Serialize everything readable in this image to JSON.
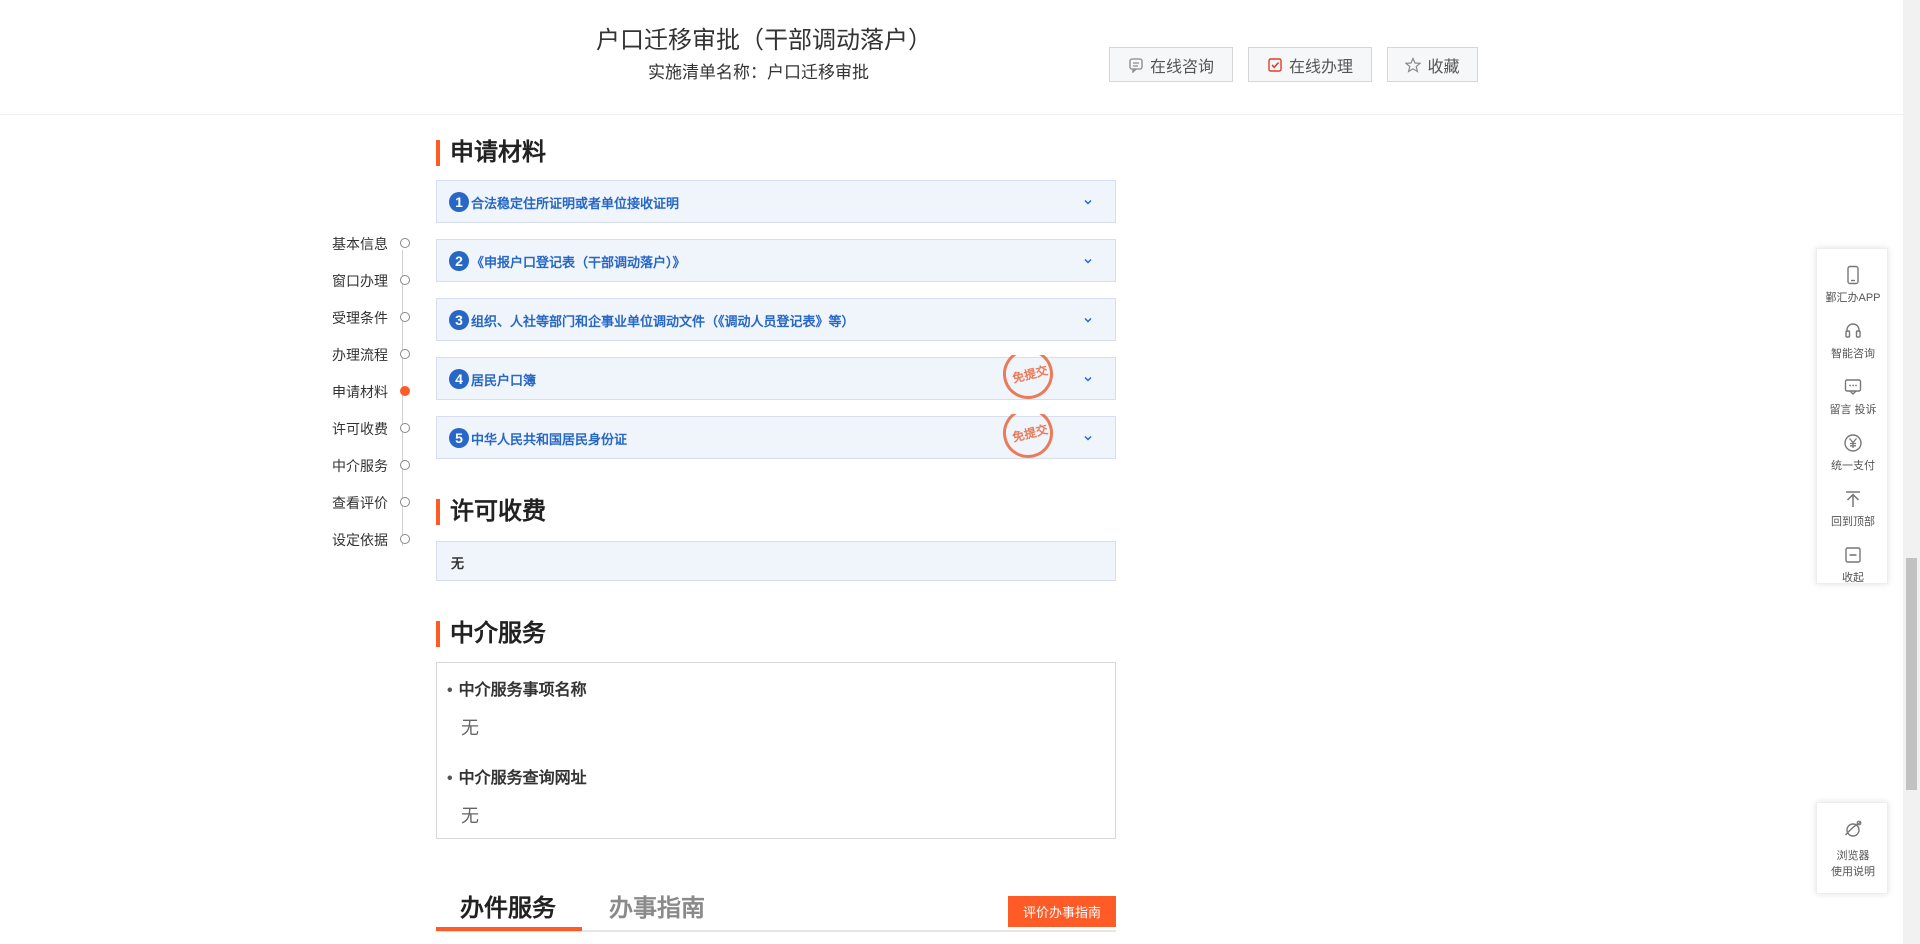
{
  "header": {
    "title": "户口迁移审批（干部调动落户）",
    "subtitle": "实施清单名称：户口迁移审批",
    "buttons": {
      "consult": "在线咨询",
      "handle": "在线办理",
      "favorite": "收藏"
    }
  },
  "nav": {
    "items": [
      {
        "label": "基本信息"
      },
      {
        "label": "窗口办理"
      },
      {
        "label": "受理条件"
      },
      {
        "label": "办理流程"
      },
      {
        "label": "申请材料"
      },
      {
        "label": "许可收费"
      },
      {
        "label": "中介服务"
      },
      {
        "label": "查看评价"
      },
      {
        "label": "设定依据"
      }
    ],
    "active": "申请材料"
  },
  "materials": {
    "title": "申请材料",
    "items": [
      {
        "num": "1",
        "label": "合法稳定住所证明或者单位接收证明"
      },
      {
        "num": "2",
        "label": "《申报户口登记表（干部调动落户）》"
      },
      {
        "num": "3",
        "label": "组织、人社等部门和企事业单位调动文件（《调动人员登记表》等）"
      },
      {
        "num": "4",
        "label": "居民户口簿",
        "stamp": "免提交"
      },
      {
        "num": "5",
        "label": "中华人民共和国居民身份证",
        "stamp": "免提交"
      }
    ]
  },
  "fees": {
    "title": "许可收费",
    "value": "无"
  },
  "agency": {
    "title": "中介服务",
    "name_label": "中介服务事项名称",
    "name_value": "无",
    "url_label": "中介服务查询网址",
    "url_value": "无"
  },
  "tabs": {
    "service": "办件服务",
    "guide": "办事指南",
    "evaluate_button": "评价办事指南"
  },
  "right_toolbar": {
    "items": [
      {
        "label": "鄞汇办APP",
        "icon": "phone-icon"
      },
      {
        "label": "智能咨询",
        "icon": "headset-icon"
      },
      {
        "label": "留言 投诉",
        "icon": "message-icon"
      },
      {
        "label": "统一支付",
        "icon": "yuan-icon"
      },
      {
        "label": "回到顶部",
        "icon": "back-to-top-icon"
      },
      {
        "label": "收起",
        "icon": "collapse-icon"
      }
    ],
    "browser_help_line1": "浏览器",
    "browser_help_line2": "使用说明"
  },
  "colors": {
    "accent": "#ff5b27",
    "link_blue": "#2767c5",
    "panel_bg": "#f0f4fb"
  }
}
